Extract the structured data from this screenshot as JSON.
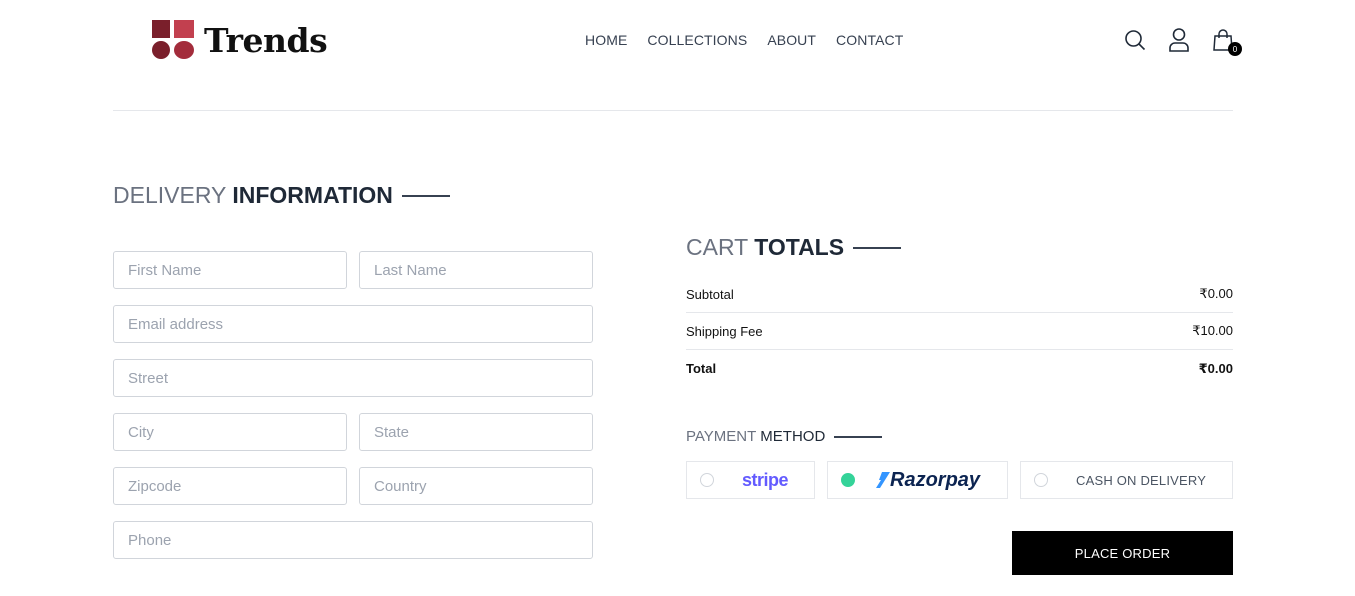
{
  "brand": {
    "name": "Trends"
  },
  "nav": {
    "items": [
      "HOME",
      "COLLECTIONS",
      "ABOUT",
      "CONTACT"
    ]
  },
  "header_icons": {
    "search": "search-icon",
    "profile": "user-icon",
    "cart": "shopping-bag-icon",
    "cart_count": "0"
  },
  "delivery": {
    "title_light": "DELIVERY",
    "title_bold": "INFORMATION",
    "fields": {
      "first_name": {
        "placeholder": "First Name",
        "value": ""
      },
      "last_name": {
        "placeholder": "Last Name",
        "value": ""
      },
      "email": {
        "placeholder": "Email address",
        "value": ""
      },
      "street": {
        "placeholder": "Street",
        "value": ""
      },
      "city": {
        "placeholder": "City",
        "value": ""
      },
      "state": {
        "placeholder": "State",
        "value": ""
      },
      "zipcode": {
        "placeholder": "Zipcode",
        "value": ""
      },
      "country": {
        "placeholder": "Country",
        "value": ""
      },
      "phone": {
        "placeholder": "Phone",
        "value": ""
      }
    }
  },
  "cart_totals": {
    "title_light": "CART",
    "title_bold": "TOTALS",
    "subtotal_label": "Subtotal",
    "subtotal_value": "₹0.00",
    "shipping_label": "Shipping Fee",
    "shipping_value": "₹10.00",
    "total_label": "Total",
    "total_value": "₹0.00"
  },
  "payment": {
    "title_light": "PAYMENT",
    "title_bold": "METHOD",
    "options": {
      "stripe": {
        "label": "stripe",
        "selected": false
      },
      "razorpay": {
        "label": "Razorpay",
        "selected": true
      },
      "cod": {
        "label": "CASH ON DELIVERY",
        "selected": false
      }
    },
    "selected_color": "#34d399"
  },
  "place_order_label": "PLACE ORDER"
}
